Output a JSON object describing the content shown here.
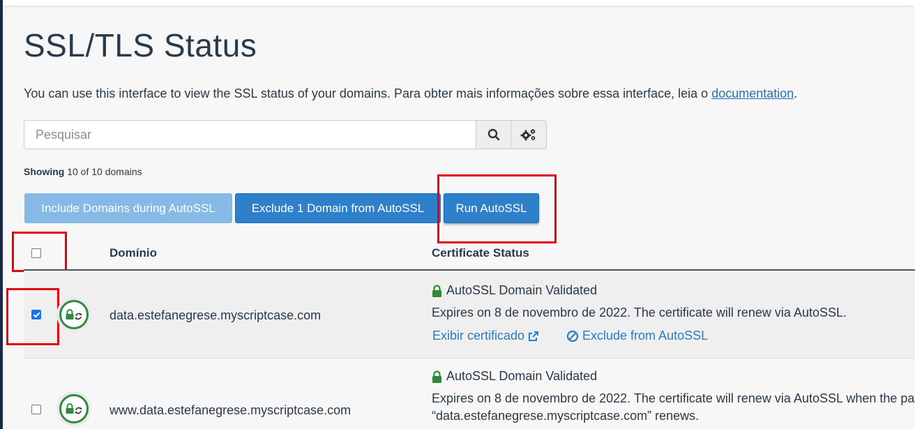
{
  "page": {
    "title": "SSL/TLS Status",
    "description": "You can use this interface to view the SSL status of your domains. Para obter mais informações sobre essa interface, leia o ",
    "doc_link": "documentation",
    "description_end": "."
  },
  "search": {
    "placeholder": "Pesquisar",
    "value": ""
  },
  "showing": {
    "label": "Showing",
    "text": " 10 of 10 domains"
  },
  "buttons": {
    "include": "Include Domains during AutoSSL",
    "exclude": "Exclude 1 Domain from AutoSSL",
    "run": "Run AutoSSL"
  },
  "table": {
    "headers": {
      "domain": "Domínio",
      "status": "Certificate Status"
    },
    "rows": [
      {
        "checked": true,
        "domain": "data.estefanegrese.myscriptcase.com",
        "status_title": "AutoSSL Domain Validated",
        "expires": "Expires on 8 de novembro de 2022. The certificate will renew via AutoSSL.",
        "view_link": "Exibir certificado",
        "exclude_link": "Exclude from AutoSSL"
      },
      {
        "checked": false,
        "domain": "www.data.estefanegrese.myscriptcase.com",
        "status_title": "AutoSSL Domain Validated",
        "expires": "Expires on 8 de novembro de 2022. The certificate will renew via AutoSSL when the pa",
        "expires_2": "“data.estefanegrese.myscriptcase.com” renews."
      }
    ]
  },
  "colors": {
    "accent": "#2f80cb",
    "success": "#2f8a3b",
    "highlight": "#e3000f"
  },
  "icons": [
    "search-icon",
    "cogs-icon",
    "lock-icon",
    "lock-sync-icon",
    "external-link-icon",
    "ban-icon"
  ]
}
